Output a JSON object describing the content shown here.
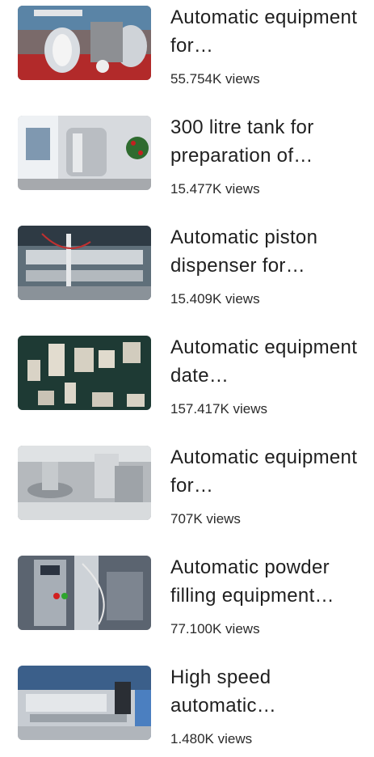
{
  "videos": [
    {
      "title": "Automatic equipment for…",
      "views": "55.754K views",
      "thumb_icon": "stainless-steel-hoppers-thumbnail",
      "thumb_color": "#b22a2a"
    },
    {
      "title": "300 litre tank for preparation of…",
      "views": "15.477K views",
      "thumb_icon": "mixing-tank-thumbnail",
      "thumb_color": "#c9ced4"
    },
    {
      "title": "Automatic piston dispenser for…",
      "views": "15.409K views",
      "thumb_icon": "piston-dispenser-thumbnail",
      "thumb_color": "#4a5a66"
    },
    {
      "title": "Automatic equipment date…",
      "views": "157.417K views",
      "thumb_icon": "date-coder-parts-thumbnail",
      "thumb_color": "#1e3a34"
    },
    {
      "title": "Automatic equipment for…",
      "views": "707K views",
      "thumb_icon": "capsule-machine-thumbnail",
      "thumb_color": "#a9adb2"
    },
    {
      "title": "Automatic powder filling equipment…",
      "views": "77.100K views",
      "thumb_icon": "powder-filling-thumbnail",
      "thumb_color": "#5b6470"
    },
    {
      "title": "High speed automatic…",
      "views": "1.480K views",
      "thumb_icon": "high-speed-line-thumbnail",
      "thumb_color": "#3b5f8a"
    }
  ]
}
